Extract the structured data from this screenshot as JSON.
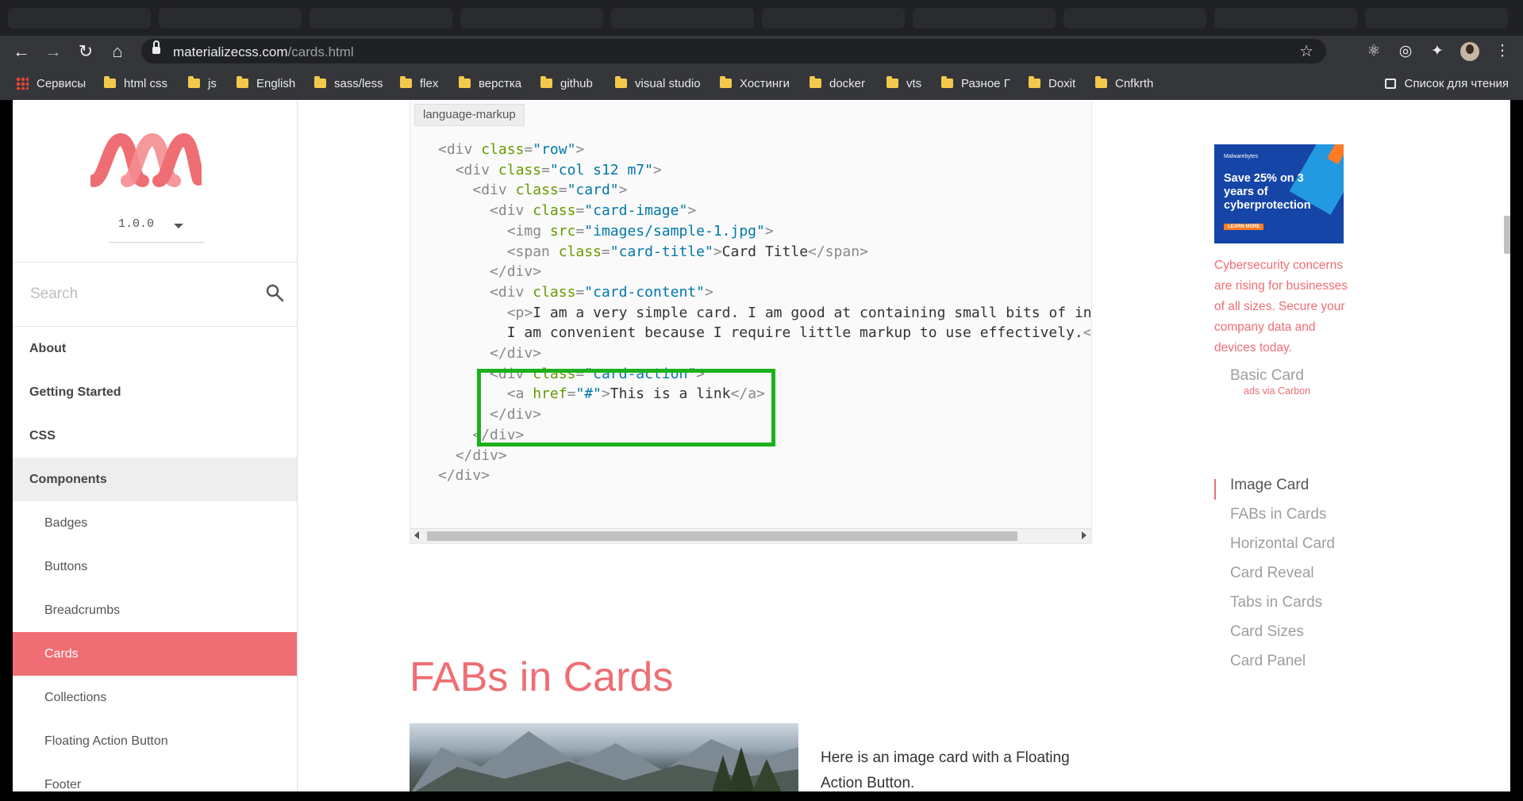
{
  "browser": {
    "url_domain": "materializecss.com",
    "url_path": "/cards.html",
    "bookmarks": [
      {
        "label": "Сервисы",
        "icon": "apps-grid-icon"
      },
      {
        "label": "html css",
        "icon": "folder-icon"
      },
      {
        "label": "js",
        "icon": "folder-icon"
      },
      {
        "label": "English",
        "icon": "folder-icon"
      },
      {
        "label": "sass/less",
        "icon": "folder-icon"
      },
      {
        "label": "flex",
        "icon": "folder-icon"
      },
      {
        "label": "верстка",
        "icon": "folder-icon"
      },
      {
        "label": "github",
        "icon": "folder-icon"
      },
      {
        "label": "visual studio",
        "icon": "folder-icon"
      },
      {
        "label": "Хостинги",
        "icon": "folder-icon"
      },
      {
        "label": "docker",
        "icon": "folder-icon"
      },
      {
        "label": "vts",
        "icon": "folder-icon"
      },
      {
        "label": "Разное Г",
        "icon": "folder-icon"
      },
      {
        "label": "Doxit",
        "icon": "folder-icon"
      },
      {
        "label": "Cnfkrth",
        "icon": "folder-icon"
      }
    ],
    "reading_list": "Список для чтения"
  },
  "sidebar": {
    "version": "1.0.0",
    "search_placeholder": "Search",
    "items": [
      {
        "label": "About",
        "level": "top"
      },
      {
        "label": "Getting Started",
        "level": "top"
      },
      {
        "label": "CSS",
        "level": "top"
      },
      {
        "label": "Components",
        "level": "top",
        "expanded": true
      },
      {
        "label": "Badges",
        "level": "sub"
      },
      {
        "label": "Buttons",
        "level": "sub"
      },
      {
        "label": "Breadcrumbs",
        "level": "sub"
      },
      {
        "label": "Cards",
        "level": "sub",
        "active": true
      },
      {
        "label": "Collections",
        "level": "sub"
      },
      {
        "label": "Floating Action Button",
        "level": "sub"
      },
      {
        "label": "Footer",
        "level": "sub"
      }
    ]
  },
  "code": {
    "language": "language-markup",
    "lines": [
      "<div class=\"row\">",
      "  <div class=\"col s12 m7\">",
      "    <div class=\"card\">",
      "      <div class=\"card-image\">",
      "        <img src=\"images/sample-1.jpg\">",
      "        <span class=\"card-title\">Card Title</span>",
      "      </div>",
      "      <div class=\"card-content\">",
      "        <p>I am a very simple card. I am good at containing small bits of information.",
      "        I am convenient because I require little markup to use effectively.</p>",
      "      </div>",
      "      <div class=\"card-action\">",
      "        <a href=\"#\">This is a link</a>",
      "      </div>",
      "    </div>",
      "  </div>",
      "</div>"
    ]
  },
  "section": {
    "title": "FABs in Cards",
    "description": "Here is an image card with a Floating Action Button."
  },
  "ad": {
    "brand": "Malwarebytes",
    "headline": "Save 25% on 3 years of cyberprotection",
    "cta": "LEARN MORE",
    "text": "Cybersecurity concerns are rising for businesses of all sizes. Secure your company data and devices today.",
    "via": "ads via Carbon"
  },
  "toc": {
    "items": [
      "Basic Card",
      "Image Card",
      "FABs in Cards",
      "Horizontal Card",
      "Card Reveal",
      "Tabs in Cards",
      "Card Sizes",
      "Card Panel"
    ],
    "active_index": 1
  },
  "colors": {
    "accent": "#ee6e73",
    "highlight_box": "#1cb11c",
    "chrome_dark": "#35363a"
  }
}
